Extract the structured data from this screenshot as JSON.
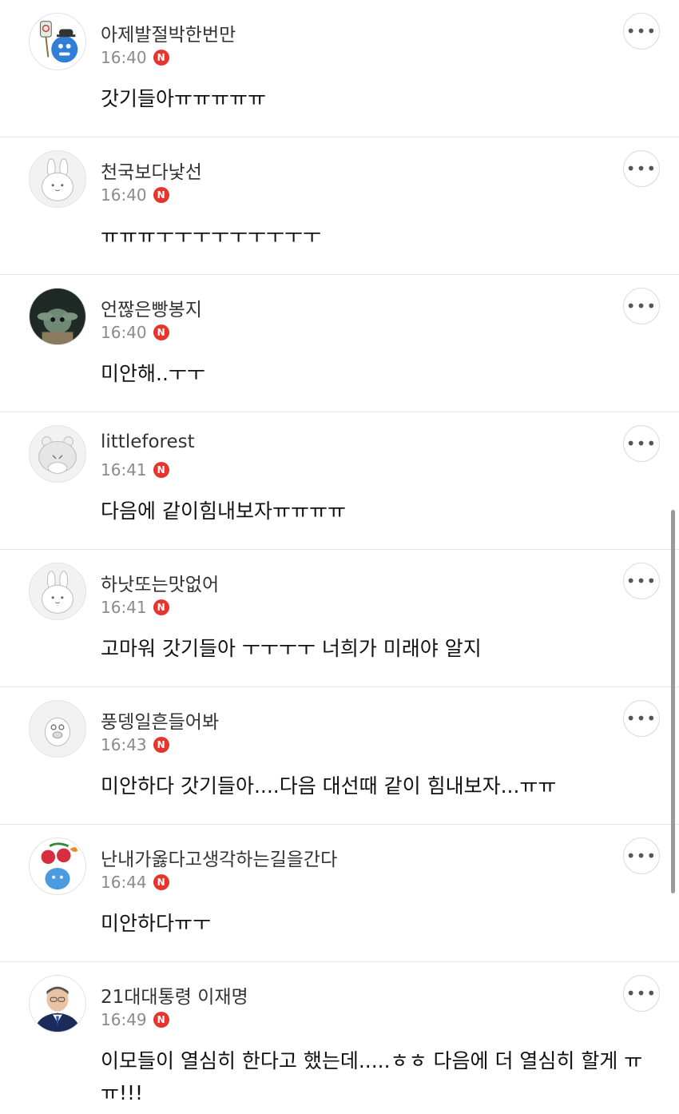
{
  "comments": [
    {
      "nickname": "아제발절박한번만",
      "time": "16:40",
      "badge": "N",
      "text": "갓기들아ㅠㅠㅠㅠㅠ",
      "more": "•••",
      "avatar": "blue-character-avatar"
    },
    {
      "nickname": "천국보다낯선",
      "time": "16:40",
      "badge": "N",
      "text": "ㅠㅠㅠㅜㅜㅜㅜㅜㅜㅜㅜㅜ",
      "more": "•••",
      "avatar": "default-bunny-avatar"
    },
    {
      "nickname": "언짢은빵봉지",
      "time": "16:40",
      "badge": "N",
      "text": "미안해..ㅜㅜ",
      "more": "•••",
      "avatar": "photo-avatar"
    },
    {
      "nickname": "littleforest",
      "time": "16:41",
      "badge": "N",
      "text": "다음에 같이힘내보자ㅠㅠㅠㅠ",
      "more": "•••",
      "avatar": "default-bear-avatar"
    },
    {
      "nickname": "하낫또는맛없어",
      "time": "16:41",
      "badge": "N",
      "text": "고마워 갓기들아 ㅜㅜㅜㅜ 너희가 미래야 알지",
      "more": "•••",
      "avatar": "default-bunny-avatar"
    },
    {
      "nickname": "풍뎅일흔들어봐",
      "time": "16:43",
      "badge": "N",
      "text": "미안하다 갓기들아....다음 대선때 같이 힘내보자...ㅠㅠ",
      "more": "•••",
      "avatar": "default-creature-avatar"
    },
    {
      "nickname": "난내가옳다고생각하는길을간다",
      "time": "16:44",
      "badge": "N",
      "text": "미안하다ㅠㅜ",
      "more": "•••",
      "avatar": "cherry-character-avatar"
    },
    {
      "nickname": "21대대통령 이재명",
      "time": "16:49",
      "badge": "N",
      "text": "이모들이 열심히 한다고 했는데.....ㅎㅎ 다음에 더 열심히 할게 ㅠㅠ!!!",
      "more": "•••",
      "avatar": "person-photo-avatar"
    }
  ],
  "colors": {
    "badge": "#e5352e",
    "divider": "#e6e6e6",
    "timestamp": "#8b8b8b"
  }
}
